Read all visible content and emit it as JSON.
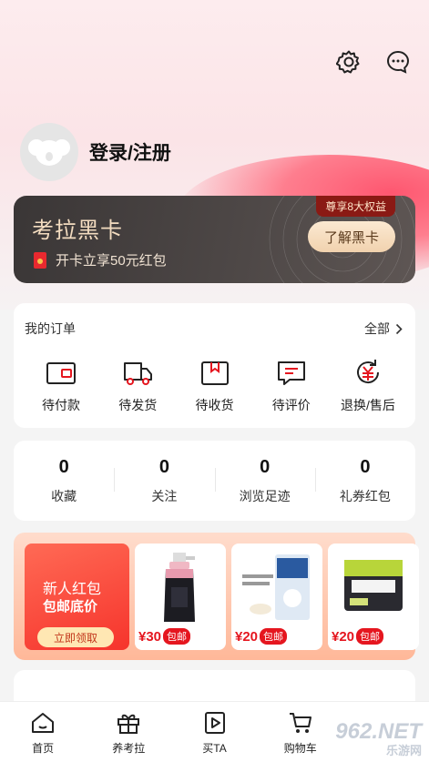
{
  "colors": {
    "brand_red": "#e5161f",
    "card_dark": "#3a3636",
    "card_gold": "#f3dcc0"
  },
  "header": {
    "icons": [
      "gear-icon",
      "chat-icon"
    ]
  },
  "login": {
    "label": "登录/注册"
  },
  "black_card": {
    "title": "考拉黑卡",
    "subtitle": "开卡立享50元红包",
    "badge": "尊享8大权益",
    "button": "了解黑卡"
  },
  "orders": {
    "title": "我的订单",
    "all_label": "全部",
    "items": [
      {
        "label": "待付款",
        "icon": "wallet-icon"
      },
      {
        "label": "待发货",
        "icon": "truck-icon"
      },
      {
        "label": "待收货",
        "icon": "package-icon"
      },
      {
        "label": "待评价",
        "icon": "comment-icon"
      },
      {
        "label": "退换/售后",
        "icon": "refund-icon"
      }
    ]
  },
  "stats": [
    {
      "value": "0",
      "label": "收藏"
    },
    {
      "value": "0",
      "label": "关注"
    },
    {
      "value": "0",
      "label": "浏览足迹"
    },
    {
      "value": "0",
      "label": "礼券红包"
    }
  ],
  "promo": {
    "line1": "新人红包",
    "line2": "包邮底价",
    "button": "立即领取",
    "products": [
      {
        "price": "¥30",
        "tag": "包邮"
      },
      {
        "price": "¥20",
        "tag": "包邮"
      },
      {
        "price": "¥20",
        "tag": "包邮"
      }
    ]
  },
  "tabbar": [
    {
      "label": "首页",
      "icon": "home-icon"
    },
    {
      "label": "养考拉",
      "icon": "gift-icon"
    },
    {
      "label": "买TA",
      "icon": "play-icon"
    },
    {
      "label": "购物车",
      "icon": "cart-icon"
    }
  ],
  "watermark": {
    "main": "962.NET",
    "sub": "乐游网"
  }
}
